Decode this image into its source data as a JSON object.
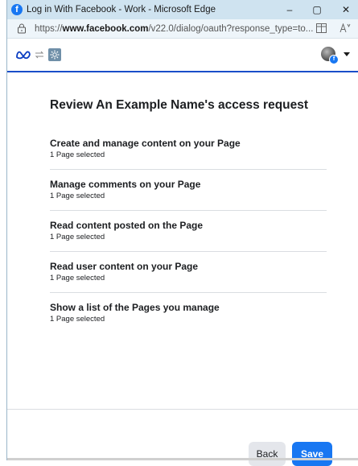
{
  "window": {
    "title": "Log in With Facebook - Work - Microsoft Edge",
    "controls": {
      "minimize": "–",
      "maximize": "▢",
      "close": "✕"
    }
  },
  "addressbar": {
    "url_prefix": "https://",
    "url_domain": "www.facebook.com",
    "url_rest": "/v22.0/dialog/oauth?response_type=to..."
  },
  "dialog": {
    "heading": "Review An Example Name's access request",
    "permissions": [
      {
        "title": "Create and manage content on your Page",
        "subtitle": "1 Page selected"
      },
      {
        "title": "Manage comments on your Page",
        "subtitle": "1 Page selected"
      },
      {
        "title": "Read content posted on the Page",
        "subtitle": "1 Page selected"
      },
      {
        "title": "Read user content on your Page",
        "subtitle": "1 Page selected"
      },
      {
        "title": "Show a list of the Pages you manage",
        "subtitle": "1 Page selected"
      }
    ],
    "buttons": {
      "back": "Back",
      "save": "Save"
    }
  },
  "colors": {
    "accent": "#1877f2",
    "header_rule": "#1a4ec9",
    "titlebar_bg": "#cfe3f0"
  },
  "icons": {
    "title": "facebook-logo-icon",
    "address": [
      "page-info-icon",
      "split-screen-icon",
      "read-aloud-icon"
    ],
    "header": [
      "meta-logo-icon",
      "sync-arrows-icon",
      "settings-gear-icon",
      "avatar",
      "dropdown-caret-icon"
    ]
  }
}
